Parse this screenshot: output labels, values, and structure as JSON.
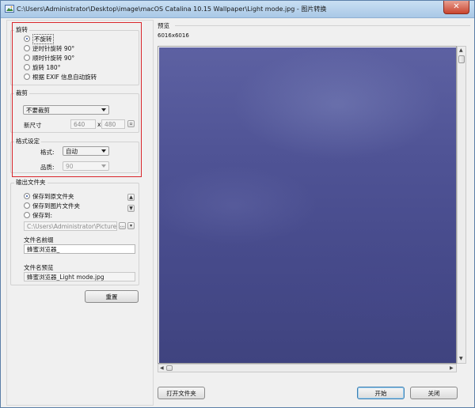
{
  "window": {
    "title": "C:\\Users\\Administrator\\Desktop\\image\\macOS Catalina 10.15 Wallpaper\\Light mode.jpg - 图片转换",
    "close_label": "✕"
  },
  "rotation": {
    "legend": "旋转",
    "options": [
      "不旋转",
      "逆时针旋转 90°",
      "顺时针旋转 90°",
      "旋转 180°",
      "根据 EXIF 信息自动旋转"
    ],
    "selected_index": 0
  },
  "crop": {
    "legend": "裁剪",
    "mode": "不要裁剪",
    "new_size_label": "新尺寸",
    "width": "640",
    "separator": "x",
    "height": "480",
    "lock_label": "∪"
  },
  "format": {
    "legend": "格式设定",
    "format_label": "格式:",
    "format_value": "自动",
    "quality_label": "品质:",
    "quality_value": "90"
  },
  "output": {
    "legend": "输出文件夹",
    "options": [
      "保存到原文件夹",
      "保存到图片文件夹",
      "保存到:"
    ],
    "selected_index": 0,
    "path": "C:\\Users\\Administrator\\Pictures\\蜂蜜",
    "browse_label": "...",
    "prefix_label": "文件名前缀",
    "prefix_value": "蜂蜜浏览器_",
    "preview_label": "文件名预览",
    "preview_value": "蜂蜜浏览器_Light mode.jpg"
  },
  "reset_label": "重置",
  "preview": {
    "label": "预览",
    "dimensions": "6016x6016"
  },
  "footer": {
    "open_folder_label": "打开文件夹",
    "start_label": "开始",
    "close_label": "关闭"
  }
}
